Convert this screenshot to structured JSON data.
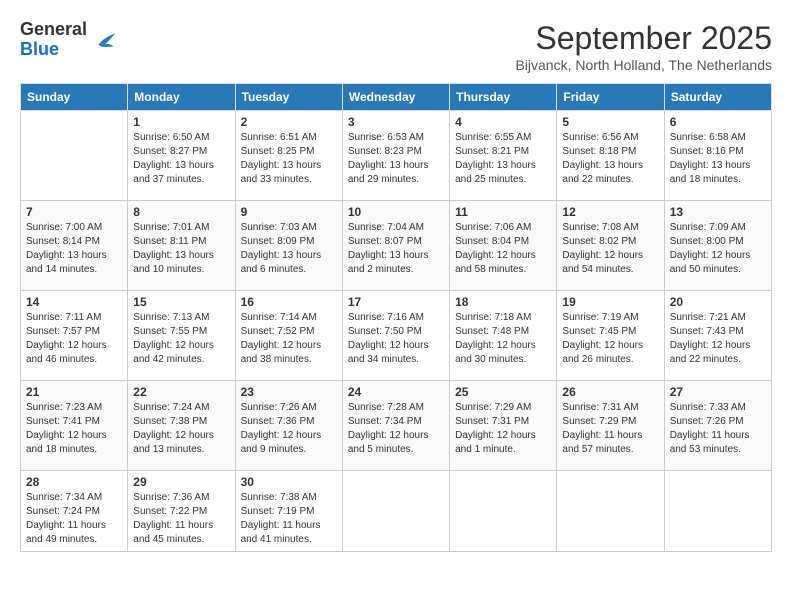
{
  "header": {
    "logo_general": "General",
    "logo_blue": "Blue",
    "month_title": "September 2025",
    "subtitle": "Bijvanck, North Holland, The Netherlands"
  },
  "days_of_week": [
    "Sunday",
    "Monday",
    "Tuesday",
    "Wednesday",
    "Thursday",
    "Friday",
    "Saturday"
  ],
  "weeks": [
    [
      {
        "day": "",
        "sunrise": "",
        "sunset": "",
        "daylight": ""
      },
      {
        "day": "1",
        "sunrise": "Sunrise: 6:50 AM",
        "sunset": "Sunset: 8:27 PM",
        "daylight": "Daylight: 13 hours and 37 minutes."
      },
      {
        "day": "2",
        "sunrise": "Sunrise: 6:51 AM",
        "sunset": "Sunset: 8:25 PM",
        "daylight": "Daylight: 13 hours and 33 minutes."
      },
      {
        "day": "3",
        "sunrise": "Sunrise: 6:53 AM",
        "sunset": "Sunset: 8:23 PM",
        "daylight": "Daylight: 13 hours and 29 minutes."
      },
      {
        "day": "4",
        "sunrise": "Sunrise: 6:55 AM",
        "sunset": "Sunset: 8:21 PM",
        "daylight": "Daylight: 13 hours and 25 minutes."
      },
      {
        "day": "5",
        "sunrise": "Sunrise: 6:56 AM",
        "sunset": "Sunset: 8:18 PM",
        "daylight": "Daylight: 13 hours and 22 minutes."
      },
      {
        "day": "6",
        "sunrise": "Sunrise: 6:58 AM",
        "sunset": "Sunset: 8:16 PM",
        "daylight": "Daylight: 13 hours and 18 minutes."
      }
    ],
    [
      {
        "day": "7",
        "sunrise": "Sunrise: 7:00 AM",
        "sunset": "Sunset: 8:14 PM",
        "daylight": "Daylight: 13 hours and 14 minutes."
      },
      {
        "day": "8",
        "sunrise": "Sunrise: 7:01 AM",
        "sunset": "Sunset: 8:11 PM",
        "daylight": "Daylight: 13 hours and 10 minutes."
      },
      {
        "day": "9",
        "sunrise": "Sunrise: 7:03 AM",
        "sunset": "Sunset: 8:09 PM",
        "daylight": "Daylight: 13 hours and 6 minutes."
      },
      {
        "day": "10",
        "sunrise": "Sunrise: 7:04 AM",
        "sunset": "Sunset: 8:07 PM",
        "daylight": "Daylight: 13 hours and 2 minutes."
      },
      {
        "day": "11",
        "sunrise": "Sunrise: 7:06 AM",
        "sunset": "Sunset: 8:04 PM",
        "daylight": "Daylight: 12 hours and 58 minutes."
      },
      {
        "day": "12",
        "sunrise": "Sunrise: 7:08 AM",
        "sunset": "Sunset: 8:02 PM",
        "daylight": "Daylight: 12 hours and 54 minutes."
      },
      {
        "day": "13",
        "sunrise": "Sunrise: 7:09 AM",
        "sunset": "Sunset: 8:00 PM",
        "daylight": "Daylight: 12 hours and 50 minutes."
      }
    ],
    [
      {
        "day": "14",
        "sunrise": "Sunrise: 7:11 AM",
        "sunset": "Sunset: 7:57 PM",
        "daylight": "Daylight: 12 hours and 46 minutes."
      },
      {
        "day": "15",
        "sunrise": "Sunrise: 7:13 AM",
        "sunset": "Sunset: 7:55 PM",
        "daylight": "Daylight: 12 hours and 42 minutes."
      },
      {
        "day": "16",
        "sunrise": "Sunrise: 7:14 AM",
        "sunset": "Sunset: 7:52 PM",
        "daylight": "Daylight: 12 hours and 38 minutes."
      },
      {
        "day": "17",
        "sunrise": "Sunrise: 7:16 AM",
        "sunset": "Sunset: 7:50 PM",
        "daylight": "Daylight: 12 hours and 34 minutes."
      },
      {
        "day": "18",
        "sunrise": "Sunrise: 7:18 AM",
        "sunset": "Sunset: 7:48 PM",
        "daylight": "Daylight: 12 hours and 30 minutes."
      },
      {
        "day": "19",
        "sunrise": "Sunrise: 7:19 AM",
        "sunset": "Sunset: 7:45 PM",
        "daylight": "Daylight: 12 hours and 26 minutes."
      },
      {
        "day": "20",
        "sunrise": "Sunrise: 7:21 AM",
        "sunset": "Sunset: 7:43 PM",
        "daylight": "Daylight: 12 hours and 22 minutes."
      }
    ],
    [
      {
        "day": "21",
        "sunrise": "Sunrise: 7:23 AM",
        "sunset": "Sunset: 7:41 PM",
        "daylight": "Daylight: 12 hours and 18 minutes."
      },
      {
        "day": "22",
        "sunrise": "Sunrise: 7:24 AM",
        "sunset": "Sunset: 7:38 PM",
        "daylight": "Daylight: 12 hours and 13 minutes."
      },
      {
        "day": "23",
        "sunrise": "Sunrise: 7:26 AM",
        "sunset": "Sunset: 7:36 PM",
        "daylight": "Daylight: 12 hours and 9 minutes."
      },
      {
        "day": "24",
        "sunrise": "Sunrise: 7:28 AM",
        "sunset": "Sunset: 7:34 PM",
        "daylight": "Daylight: 12 hours and 5 minutes."
      },
      {
        "day": "25",
        "sunrise": "Sunrise: 7:29 AM",
        "sunset": "Sunset: 7:31 PM",
        "daylight": "Daylight: 12 hours and 1 minute."
      },
      {
        "day": "26",
        "sunrise": "Sunrise: 7:31 AM",
        "sunset": "Sunset: 7:29 PM",
        "daylight": "Daylight: 11 hours and 57 minutes."
      },
      {
        "day": "27",
        "sunrise": "Sunrise: 7:33 AM",
        "sunset": "Sunset: 7:26 PM",
        "daylight": "Daylight: 11 hours and 53 minutes."
      }
    ],
    [
      {
        "day": "28",
        "sunrise": "Sunrise: 7:34 AM",
        "sunset": "Sunset: 7:24 PM",
        "daylight": "Daylight: 11 hours and 49 minutes."
      },
      {
        "day": "29",
        "sunrise": "Sunrise: 7:36 AM",
        "sunset": "Sunset: 7:22 PM",
        "daylight": "Daylight: 11 hours and 45 minutes."
      },
      {
        "day": "30",
        "sunrise": "Sunrise: 7:38 AM",
        "sunset": "Sunset: 7:19 PM",
        "daylight": "Daylight: 11 hours and 41 minutes."
      },
      {
        "day": "",
        "sunrise": "",
        "sunset": "",
        "daylight": ""
      },
      {
        "day": "",
        "sunrise": "",
        "sunset": "",
        "daylight": ""
      },
      {
        "day": "",
        "sunrise": "",
        "sunset": "",
        "daylight": ""
      },
      {
        "day": "",
        "sunrise": "",
        "sunset": "",
        "daylight": ""
      }
    ]
  ]
}
